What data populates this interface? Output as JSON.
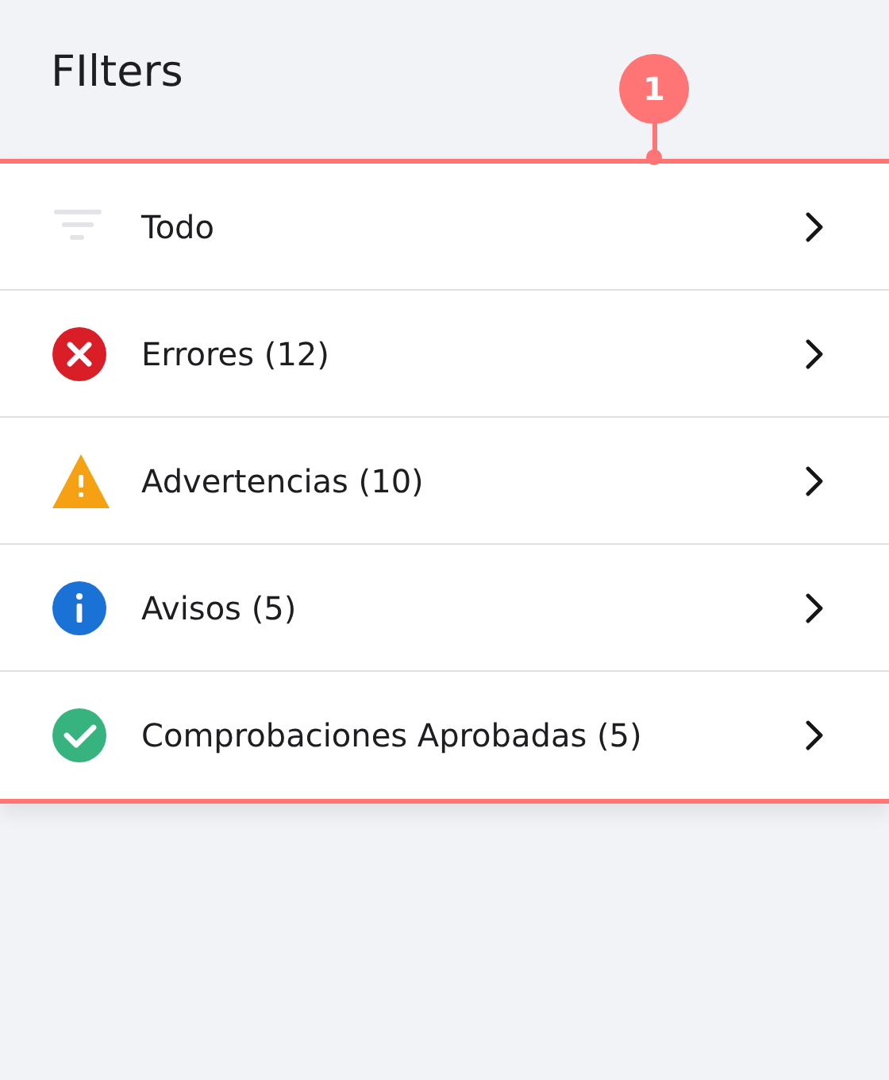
{
  "title": "FIlters",
  "annotation": {
    "label": "1"
  },
  "filters": [
    {
      "kind": "all",
      "label": "Todo"
    },
    {
      "kind": "error",
      "label": "Errores (12)"
    },
    {
      "kind": "warning",
      "label": "Advertencias (10)"
    },
    {
      "kind": "info",
      "label": "Avisos (5)"
    },
    {
      "kind": "pass",
      "label": "Comprobaciones Aprobadas (5)"
    }
  ]
}
